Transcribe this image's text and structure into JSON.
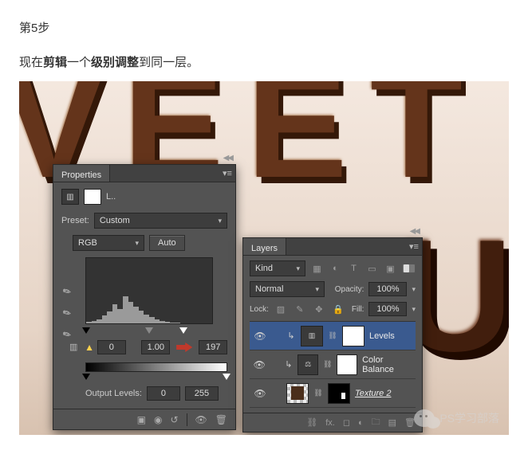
{
  "article": {
    "step_heading": "第5步",
    "body_prefix": "现在",
    "body_bold1": "剪辑",
    "body_mid": "一个",
    "body_bold2": "级别调整",
    "body_suffix": "到同一层。"
  },
  "bg_letters": {
    "l0": "V",
    "l1": "E",
    "l2": "E",
    "l3": "T",
    "l4": "U"
  },
  "properties_panel": {
    "title": "Properties",
    "adj_icon_name": "levels-icon",
    "adj_short": "L..",
    "preset_label": "Preset:",
    "preset_value": "Custom",
    "channel_value": "RGB",
    "auto_btn": "Auto",
    "input_black": "0",
    "input_gamma": "1.00",
    "input_white": "197",
    "output_label": "Output Levels:",
    "output_black": "0",
    "output_white": "255"
  },
  "layers_panel": {
    "title": "Layers",
    "filter_kind": "Kind",
    "blend_mode": "Normal",
    "opacity_label": "Opacity:",
    "opacity_value": "100%",
    "lock_label": "Lock:",
    "fill_label": "Fill:",
    "fill_value": "100%",
    "rows": {
      "0": {
        "name": "Levels"
      },
      "1": {
        "name": "Color Balance"
      },
      "2": {
        "name": "Texture 2"
      }
    }
  },
  "watermark": {
    "text": "PS学习部落"
  }
}
